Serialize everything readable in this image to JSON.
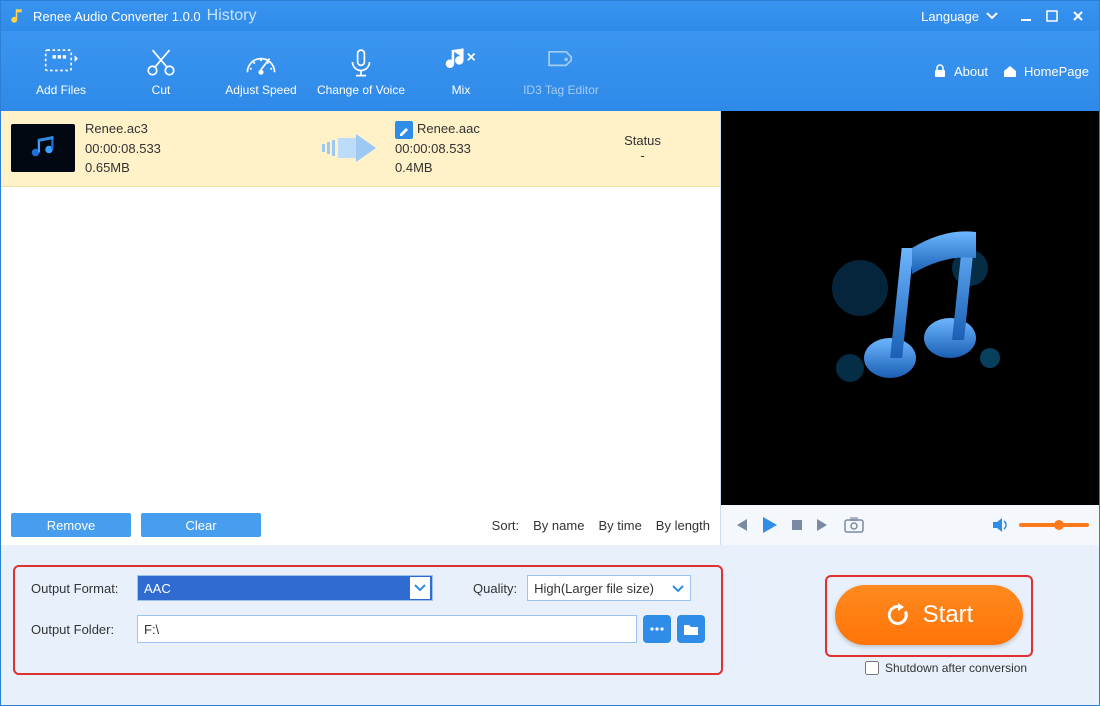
{
  "title": "Renee Audio Converter 1.0.0",
  "history": "History",
  "language": "Language",
  "links": {
    "about": "About",
    "homepage": "HomePage"
  },
  "tools": {
    "add": "Add Files",
    "cut": "Cut",
    "speed": "Adjust Speed",
    "voice": "Change of Voice",
    "mix": "Mix",
    "id3": "ID3 Tag Editor"
  },
  "file": {
    "src_name": "Renee.ac3",
    "src_dur": "00:00:08.533",
    "src_size": "0.65MB",
    "dst_name": "Renee.aac",
    "dst_dur": "00:00:08.533",
    "dst_size": "0.4MB",
    "status_label": "Status",
    "status_value": "-"
  },
  "buttons": {
    "remove": "Remove",
    "clear": "Clear"
  },
  "sort": {
    "label": "Sort:",
    "name": "By name",
    "time": "By time",
    "length": "By length"
  },
  "settings": {
    "format_label": "Output Format:",
    "format_value": "AAC",
    "quality_label": "Quality:",
    "quality_value": "High(Larger file size)",
    "folder_label": "Output Folder:",
    "folder_value": "F:\\"
  },
  "start": "Start",
  "shutdown": "Shutdown after conversion"
}
